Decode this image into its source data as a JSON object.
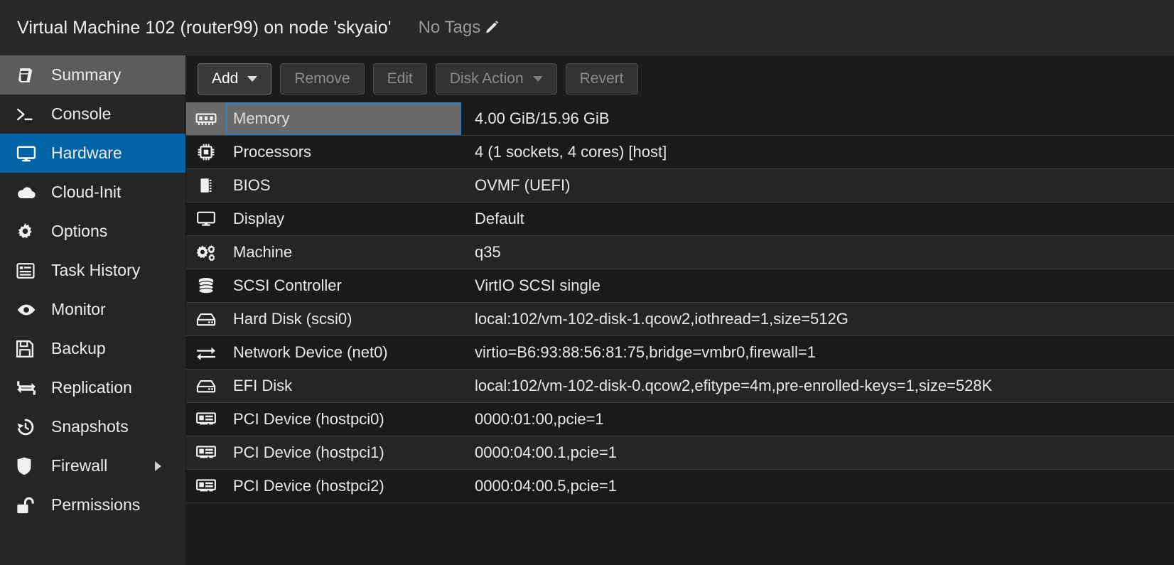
{
  "header": {
    "title": "Virtual Machine 102 (router99) on node 'skyaio'",
    "tags_label": "No Tags",
    "edit_tags_icon": "pencil-icon"
  },
  "theme": {
    "accent_blue": "#0063a6",
    "focus_blue": "#2a7fc9",
    "bg_dark": "#1c1c1c",
    "row_odd": "#252525",
    "row_even": "#1a1a1a",
    "selected_gray": "#6a6a6a"
  },
  "sidebar": {
    "items": [
      {
        "label": "Summary",
        "icon": "book-icon",
        "state": "hovered"
      },
      {
        "label": "Console",
        "icon": "terminal-icon",
        "state": "normal"
      },
      {
        "label": "Hardware",
        "icon": "monitor-icon",
        "state": "active"
      },
      {
        "label": "Cloud-Init",
        "icon": "cloud-icon",
        "state": "normal"
      },
      {
        "label": "Options",
        "icon": "gear-icon",
        "state": "normal"
      },
      {
        "label": "Task History",
        "icon": "list-icon",
        "state": "normal"
      },
      {
        "label": "Monitor",
        "icon": "eye-icon",
        "state": "normal"
      },
      {
        "label": "Backup",
        "icon": "floppy-icon",
        "state": "normal"
      },
      {
        "label": "Replication",
        "icon": "sync-icon",
        "state": "normal"
      },
      {
        "label": "Snapshots",
        "icon": "history-icon",
        "state": "normal"
      },
      {
        "label": "Firewall",
        "icon": "shield-icon",
        "state": "normal",
        "has_submenu": true
      },
      {
        "label": "Permissions",
        "icon": "unlock-icon",
        "state": "normal"
      }
    ]
  },
  "toolbar": {
    "buttons": [
      {
        "label": "Add",
        "enabled": true,
        "caret": true
      },
      {
        "label": "Remove",
        "enabled": false,
        "caret": false
      },
      {
        "label": "Edit",
        "enabled": false,
        "caret": false
      },
      {
        "label": "Disk Action",
        "enabled": false,
        "caret": true
      },
      {
        "label": "Revert",
        "enabled": false,
        "caret": false
      }
    ]
  },
  "hardware_table": {
    "rows": [
      {
        "icon": "memory-icon",
        "name": "Memory",
        "value": "4.00 GiB/15.96 GiB",
        "selected": true
      },
      {
        "icon": "cpu-icon",
        "name": "Processors",
        "value": "4 (1 sockets, 4 cores) [host]",
        "selected": false
      },
      {
        "icon": "bios-chip-icon",
        "name": "BIOS",
        "value": "OVMF (UEFI)",
        "selected": false
      },
      {
        "icon": "display-icon",
        "name": "Display",
        "value": "Default",
        "selected": false
      },
      {
        "icon": "gears-icon",
        "name": "Machine",
        "value": "q35",
        "selected": false
      },
      {
        "icon": "database-icon",
        "name": "SCSI Controller",
        "value": "VirtIO SCSI single",
        "selected": false
      },
      {
        "icon": "harddisk-icon",
        "name": "Hard Disk (scsi0)",
        "value": "local:102/vm-102-disk-1.qcow2,iothread=1,size=512G",
        "selected": false
      },
      {
        "icon": "network-icon",
        "name": "Network Device (net0)",
        "value": "virtio=B6:93:88:56:81:75,bridge=vmbr0,firewall=1",
        "selected": false
      },
      {
        "icon": "harddisk-icon",
        "name": "EFI Disk",
        "value": "local:102/vm-102-disk-0.qcow2,efitype=4m,pre-enrolled-keys=1,size=528K",
        "selected": false
      },
      {
        "icon": "pcicard-icon",
        "name": "PCI Device (hostpci0)",
        "value": "0000:01:00,pcie=1",
        "selected": false
      },
      {
        "icon": "pcicard-icon",
        "name": "PCI Device (hostpci1)",
        "value": "0000:04:00.1,pcie=1",
        "selected": false
      },
      {
        "icon": "pcicard-icon",
        "name": "PCI Device (hostpci2)",
        "value": "0000:04:00.5,pcie=1",
        "selected": false
      }
    ]
  }
}
